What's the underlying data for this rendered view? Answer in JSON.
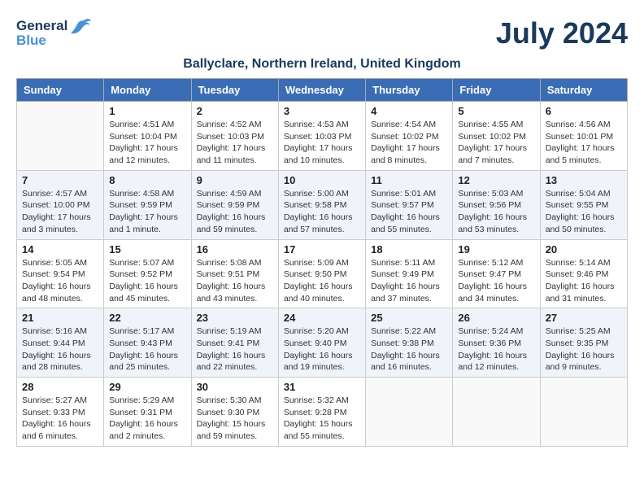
{
  "header": {
    "logo_line1": "General",
    "logo_line2": "Blue",
    "title": "July 2024",
    "subtitle": "Ballyclare, Northern Ireland, United Kingdom"
  },
  "days_of_week": [
    "Sunday",
    "Monday",
    "Tuesday",
    "Wednesday",
    "Thursday",
    "Friday",
    "Saturday"
  ],
  "weeks": [
    [
      {
        "day": "",
        "info": ""
      },
      {
        "day": "1",
        "info": "Sunrise: 4:51 AM\nSunset: 10:04 PM\nDaylight: 17 hours\nand 12 minutes."
      },
      {
        "day": "2",
        "info": "Sunrise: 4:52 AM\nSunset: 10:03 PM\nDaylight: 17 hours\nand 11 minutes."
      },
      {
        "day": "3",
        "info": "Sunrise: 4:53 AM\nSunset: 10:03 PM\nDaylight: 17 hours\nand 10 minutes."
      },
      {
        "day": "4",
        "info": "Sunrise: 4:54 AM\nSunset: 10:02 PM\nDaylight: 17 hours\nand 8 minutes."
      },
      {
        "day": "5",
        "info": "Sunrise: 4:55 AM\nSunset: 10:02 PM\nDaylight: 17 hours\nand 7 minutes."
      },
      {
        "day": "6",
        "info": "Sunrise: 4:56 AM\nSunset: 10:01 PM\nDaylight: 17 hours\nand 5 minutes."
      }
    ],
    [
      {
        "day": "7",
        "info": "Sunrise: 4:57 AM\nSunset: 10:00 PM\nDaylight: 17 hours\nand 3 minutes."
      },
      {
        "day": "8",
        "info": "Sunrise: 4:58 AM\nSunset: 9:59 PM\nDaylight: 17 hours\nand 1 minute."
      },
      {
        "day": "9",
        "info": "Sunrise: 4:59 AM\nSunset: 9:59 PM\nDaylight: 16 hours\nand 59 minutes."
      },
      {
        "day": "10",
        "info": "Sunrise: 5:00 AM\nSunset: 9:58 PM\nDaylight: 16 hours\nand 57 minutes."
      },
      {
        "day": "11",
        "info": "Sunrise: 5:01 AM\nSunset: 9:57 PM\nDaylight: 16 hours\nand 55 minutes."
      },
      {
        "day": "12",
        "info": "Sunrise: 5:03 AM\nSunset: 9:56 PM\nDaylight: 16 hours\nand 53 minutes."
      },
      {
        "day": "13",
        "info": "Sunrise: 5:04 AM\nSunset: 9:55 PM\nDaylight: 16 hours\nand 50 minutes."
      }
    ],
    [
      {
        "day": "14",
        "info": "Sunrise: 5:05 AM\nSunset: 9:54 PM\nDaylight: 16 hours\nand 48 minutes."
      },
      {
        "day": "15",
        "info": "Sunrise: 5:07 AM\nSunset: 9:52 PM\nDaylight: 16 hours\nand 45 minutes."
      },
      {
        "day": "16",
        "info": "Sunrise: 5:08 AM\nSunset: 9:51 PM\nDaylight: 16 hours\nand 43 minutes."
      },
      {
        "day": "17",
        "info": "Sunrise: 5:09 AM\nSunset: 9:50 PM\nDaylight: 16 hours\nand 40 minutes."
      },
      {
        "day": "18",
        "info": "Sunrise: 5:11 AM\nSunset: 9:49 PM\nDaylight: 16 hours\nand 37 minutes."
      },
      {
        "day": "19",
        "info": "Sunrise: 5:12 AM\nSunset: 9:47 PM\nDaylight: 16 hours\nand 34 minutes."
      },
      {
        "day": "20",
        "info": "Sunrise: 5:14 AM\nSunset: 9:46 PM\nDaylight: 16 hours\nand 31 minutes."
      }
    ],
    [
      {
        "day": "21",
        "info": "Sunrise: 5:16 AM\nSunset: 9:44 PM\nDaylight: 16 hours\nand 28 minutes."
      },
      {
        "day": "22",
        "info": "Sunrise: 5:17 AM\nSunset: 9:43 PM\nDaylight: 16 hours\nand 25 minutes."
      },
      {
        "day": "23",
        "info": "Sunrise: 5:19 AM\nSunset: 9:41 PM\nDaylight: 16 hours\nand 22 minutes."
      },
      {
        "day": "24",
        "info": "Sunrise: 5:20 AM\nSunset: 9:40 PM\nDaylight: 16 hours\nand 19 minutes."
      },
      {
        "day": "25",
        "info": "Sunrise: 5:22 AM\nSunset: 9:38 PM\nDaylight: 16 hours\nand 16 minutes."
      },
      {
        "day": "26",
        "info": "Sunrise: 5:24 AM\nSunset: 9:36 PM\nDaylight: 16 hours\nand 12 minutes."
      },
      {
        "day": "27",
        "info": "Sunrise: 5:25 AM\nSunset: 9:35 PM\nDaylight: 16 hours\nand 9 minutes."
      }
    ],
    [
      {
        "day": "28",
        "info": "Sunrise: 5:27 AM\nSunset: 9:33 PM\nDaylight: 16 hours\nand 6 minutes."
      },
      {
        "day": "29",
        "info": "Sunrise: 5:29 AM\nSunset: 9:31 PM\nDaylight: 16 hours\nand 2 minutes."
      },
      {
        "day": "30",
        "info": "Sunrise: 5:30 AM\nSunset: 9:30 PM\nDaylight: 15 hours\nand 59 minutes."
      },
      {
        "day": "31",
        "info": "Sunrise: 5:32 AM\nSunset: 9:28 PM\nDaylight: 15 hours\nand 55 minutes."
      },
      {
        "day": "",
        "info": ""
      },
      {
        "day": "",
        "info": ""
      },
      {
        "day": "",
        "info": ""
      }
    ]
  ],
  "row_shade": "#f0f4fa",
  "row_plain": "#ffffff"
}
